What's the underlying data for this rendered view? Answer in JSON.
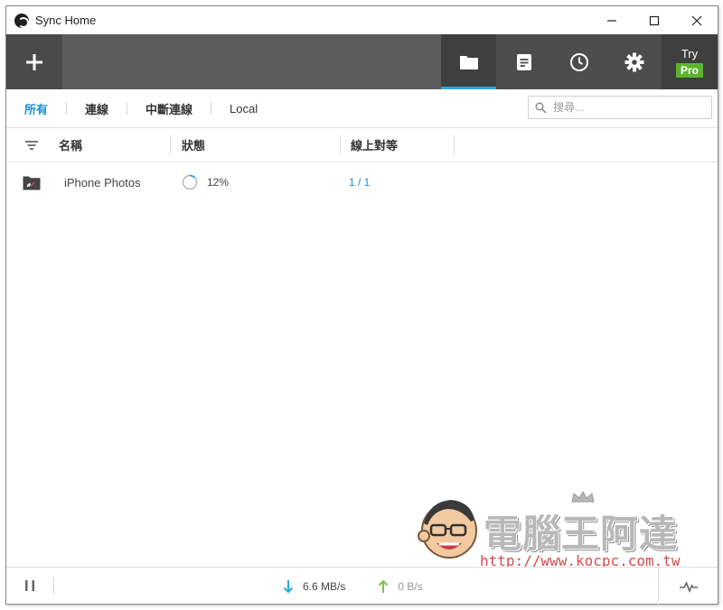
{
  "window": {
    "title": "Sync Home",
    "controls": {
      "minimize": "minimize-icon",
      "maximize": "maximize-icon",
      "close": "close-icon"
    }
  },
  "toolbar": {
    "add_icon": "plus-icon",
    "buttons": [
      {
        "name": "folders",
        "icon": "folder-icon",
        "active": true
      },
      {
        "name": "transfers",
        "icon": "document-icon",
        "active": false
      },
      {
        "name": "history",
        "icon": "clock-icon",
        "active": false
      },
      {
        "name": "preferences",
        "icon": "gear-icon",
        "active": false
      }
    ],
    "try_label": "Try",
    "pro_label": "Pro",
    "accent_color": "#29a9e1",
    "pro_color": "#5cb531"
  },
  "filters": {
    "tabs": [
      "所有",
      "連線",
      "中斷連線",
      "Local"
    ],
    "active_index": 0,
    "search_placeholder": "搜尋..."
  },
  "columns": {
    "name": "名稱",
    "status": "狀態",
    "peers": "線上對等"
  },
  "rows": [
    {
      "name": "iPhone Photos",
      "progress_text": "12%",
      "progress": 0.12,
      "peers": "1 / 1"
    }
  ],
  "watermark": {
    "title": "電腦王阿達",
    "url": "http://www.kocpc.com.tw"
  },
  "statusbar": {
    "download_rate": "6.6 MB/s",
    "upload_rate": "0 B/s",
    "download_color": "#29a9e1",
    "upload_color": "#7cc44e"
  }
}
